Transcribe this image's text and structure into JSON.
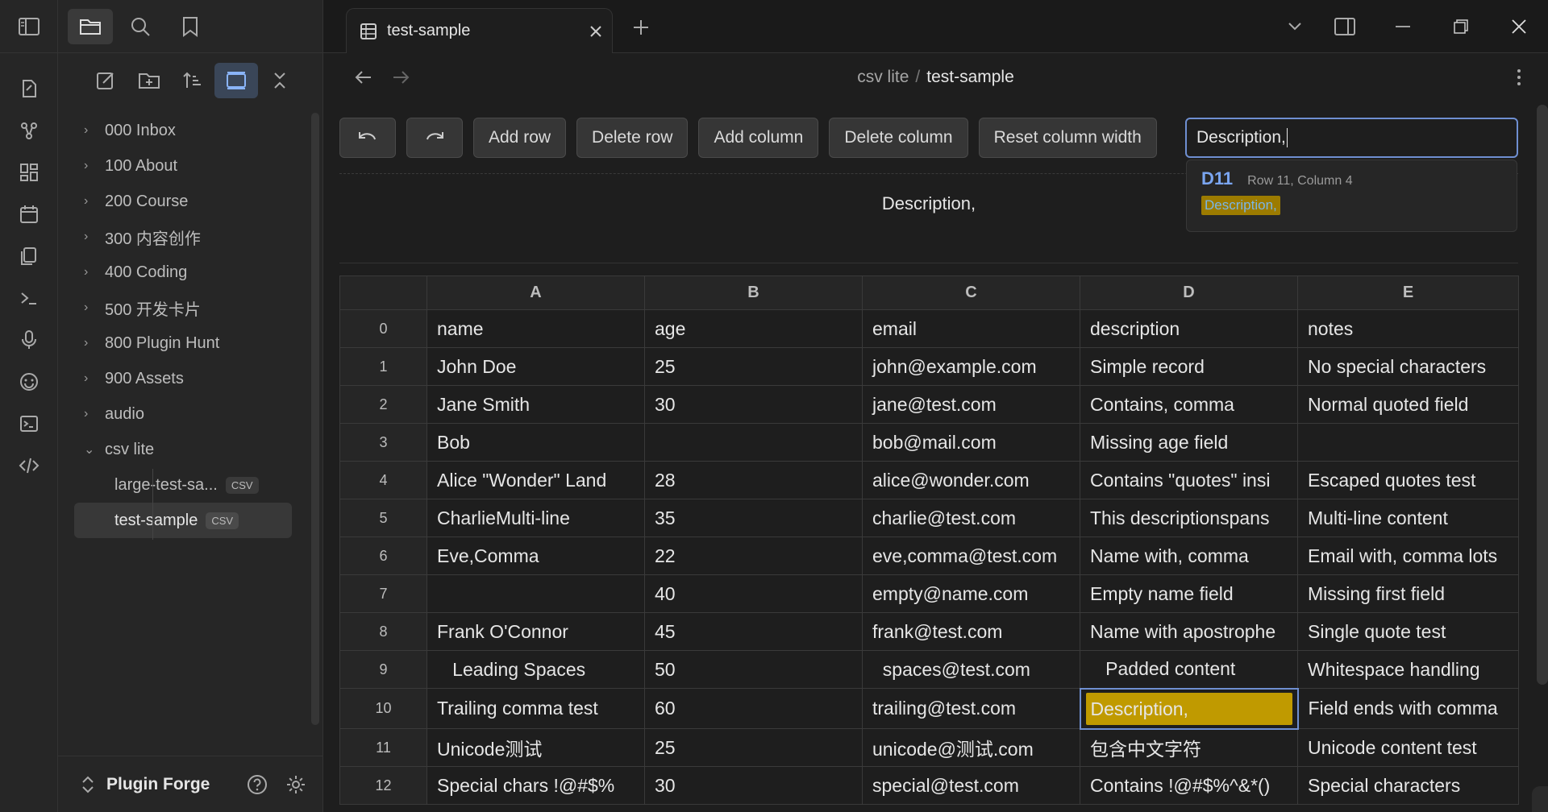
{
  "colors": {
    "accent": "#6f8fd1",
    "highlight": "#c09a00",
    "match_text": "#7aa5f0"
  },
  "ribbon": {
    "top_icon": "sidebar-toggle-icon",
    "items": [
      "new-note-icon",
      "graph-icon",
      "canvas-icon",
      "calendar-icon",
      "copy-icon",
      "terminal-icon",
      "microphone-icon",
      "smile-icon",
      "console-icon",
      "code-icon"
    ]
  },
  "sidebar": {
    "tabs": [
      "files-icon",
      "search-icon",
      "bookmark-icon"
    ],
    "actions": [
      "new-note-icon",
      "new-folder-icon",
      "sort-icon",
      "collapse-view-icon",
      "close-all-icon"
    ],
    "folders": [
      "000 Inbox",
      "100 About",
      "200 Course",
      "300 内容创作",
      "400 Coding",
      "500 开发卡片",
      "800 Plugin Hunt",
      "900 Assets",
      "audio"
    ],
    "open_folder": "csv lite",
    "files": [
      {
        "name": "large-test-sa...",
        "ext": "CSV"
      },
      {
        "name": "test-sample",
        "ext": "CSV"
      }
    ],
    "vault": "Plugin Forge"
  },
  "tab": {
    "title": "test-sample"
  },
  "breadcrumb": {
    "folder": "csv lite",
    "separator": "/",
    "file": "test-sample"
  },
  "toolbar": {
    "add_row": "Add row",
    "delete_row": "Delete row",
    "add_column": "Add column",
    "delete_column": "Delete column",
    "reset_width": "Reset column width"
  },
  "search": {
    "value": "Description,"
  },
  "search_result": {
    "ref": "D11",
    "position": "Row 11, Column 4",
    "match": "Description,"
  },
  "cell_preview": "Description,",
  "grid": {
    "columns": [
      "A",
      "B",
      "C",
      "D",
      "E"
    ],
    "rows": [
      [
        "0",
        "name",
        "age",
        "email",
        "description",
        "notes"
      ],
      [
        "1",
        "John Doe",
        "25",
        "john@example.com",
        "Simple record",
        "No special characters"
      ],
      [
        "2",
        "Jane Smith",
        "30",
        "jane@test.com",
        "Contains, comma",
        "Normal quoted field"
      ],
      [
        "3",
        "Bob",
        "",
        "bob@mail.com",
        "Missing age field",
        ""
      ],
      [
        "4",
        "Alice \"Wonder\" Land",
        "28",
        "alice@wonder.com",
        "Contains \"quotes\" insi",
        "Escaped quotes test"
      ],
      [
        "5",
        "CharlieMulti-line",
        "35",
        "charlie@test.com",
        "This descriptionspans",
        "Multi-line content"
      ],
      [
        "6",
        "Eve,Comma",
        "22",
        "eve,comma@test.com",
        "Name with, comma",
        "Email with, comma lots"
      ],
      [
        "7",
        "",
        "40",
        "empty@name.com",
        "Empty name field",
        "Missing first field"
      ],
      [
        "8",
        "Frank O'Connor",
        "45",
        "frank@test.com",
        "Name with apostrophe",
        "Single quote test"
      ],
      [
        "9",
        "   Leading Spaces",
        "50",
        "  spaces@test.com",
        "   Padded content",
        "Whitespace handling"
      ],
      [
        "10",
        "Trailing comma test",
        "60",
        "trailing@test.com",
        "Description,",
        "Field ends with comma"
      ],
      [
        "11",
        "Unicode测试",
        "25",
        "unicode@测试.com",
        "包含中文字符",
        "Unicode content test"
      ],
      [
        "12",
        "Special chars !@#$%",
        "30",
        "special@test.com",
        "Contains !@#$%^&*()",
        "Special characters"
      ]
    ]
  }
}
